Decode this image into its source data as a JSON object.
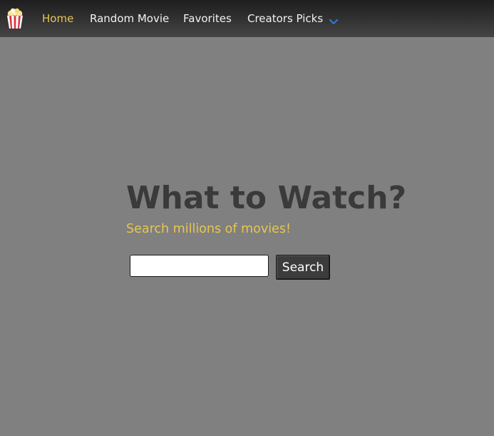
{
  "navbar": {
    "logo_icon": "popcorn-icon",
    "items": [
      {
        "label": "Home",
        "active": true
      },
      {
        "label": "Random Movie",
        "active": false
      },
      {
        "label": "Favorites",
        "active": false
      },
      {
        "label": "Creators Picks",
        "active": false,
        "has_dropdown": true
      }
    ],
    "dropdown_icon": "chevron-down-icon"
  },
  "hero": {
    "title": "What to Watch?",
    "subtitle": "Search millions of movies!"
  },
  "search": {
    "input_value": "",
    "button_label": "Search"
  },
  "colors": {
    "background": "#808080",
    "accent": "#e7c64f",
    "title": "#3a3a3a",
    "chevron": "#2f78d8"
  }
}
